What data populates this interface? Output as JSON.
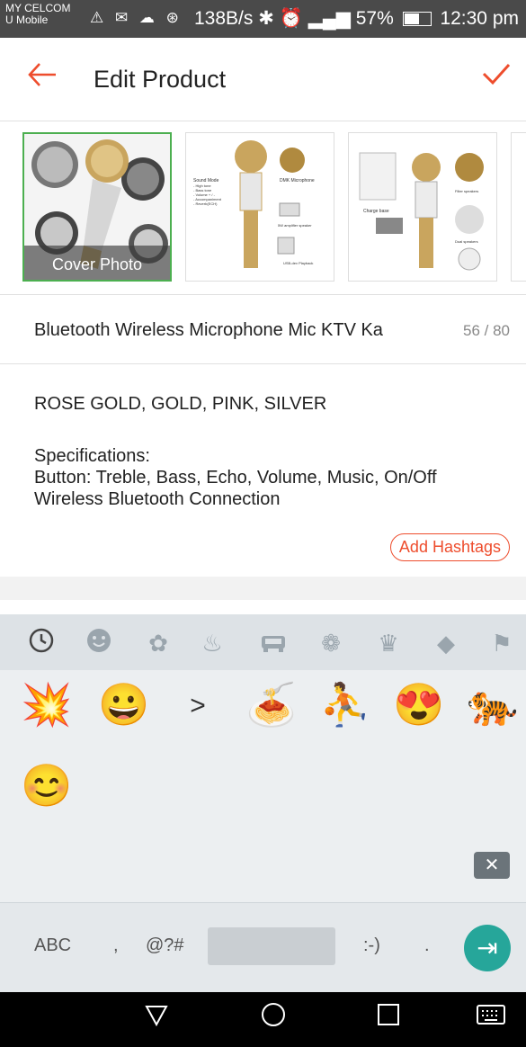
{
  "status_bar": {
    "carrier_line1": "MY CELCOM",
    "carrier_line2": "U Mobile",
    "net_speed": "138B/s",
    "battery": "57%",
    "time": "12:30 pm"
  },
  "appbar": {
    "title": "Edit Product",
    "back_icon": "arrow-left-icon",
    "confirm_icon": "check-icon",
    "accent_color": "#ee4d2d"
  },
  "photos": {
    "cover_caption": "Cover Photo",
    "items": [
      {
        "type": "cover"
      },
      {
        "type": "spec",
        "labels": [
          "Sound Mode",
          "- High tone",
          "- Bass tone",
          "- Volume + / -",
          "- Accompaniment",
          "- Reverb(ECH)",
          "DMK Microphone",
          "5W amplifier speaker",
          "USB-dev Playback"
        ]
      },
      {
        "type": "diagram",
        "labels": [
          "Charge base",
          "Filter speakers",
          "Dual speakers"
        ]
      },
      {
        "type": "partial"
      }
    ]
  },
  "product": {
    "name": "Bluetooth Wireless Microphone Mic KTV Ka",
    "name_count": "56 / 80"
  },
  "description": {
    "lines": [
      "ROSE GOLD, GOLD, PINK, SILVER",
      "",
      "Specifications:",
      "Button: Treble, Bass, Echo, Volume, Music, On/Off",
      "Wireless Bluetooth Connection"
    ],
    "hashtag_button": "Add Hashtags"
  },
  "keyboard": {
    "categories": [
      "recent-icon",
      "smiley-icon",
      "nature-icon",
      "food-icon",
      "car-icon",
      "sports-icon",
      "crown-icon",
      "diamond-icon",
      "flag-icon"
    ],
    "emojis_row1": [
      "💥",
      "😀",
      ">",
      "🍝",
      "⛹",
      "😍",
      "🐅"
    ],
    "emojis_row2": [
      "😊"
    ],
    "keys": {
      "abc": "ABC",
      "comma": ",",
      "symbols": "@?#",
      "emoticon": ":-)",
      "period": "."
    },
    "enter_color": "#26a69a"
  }
}
